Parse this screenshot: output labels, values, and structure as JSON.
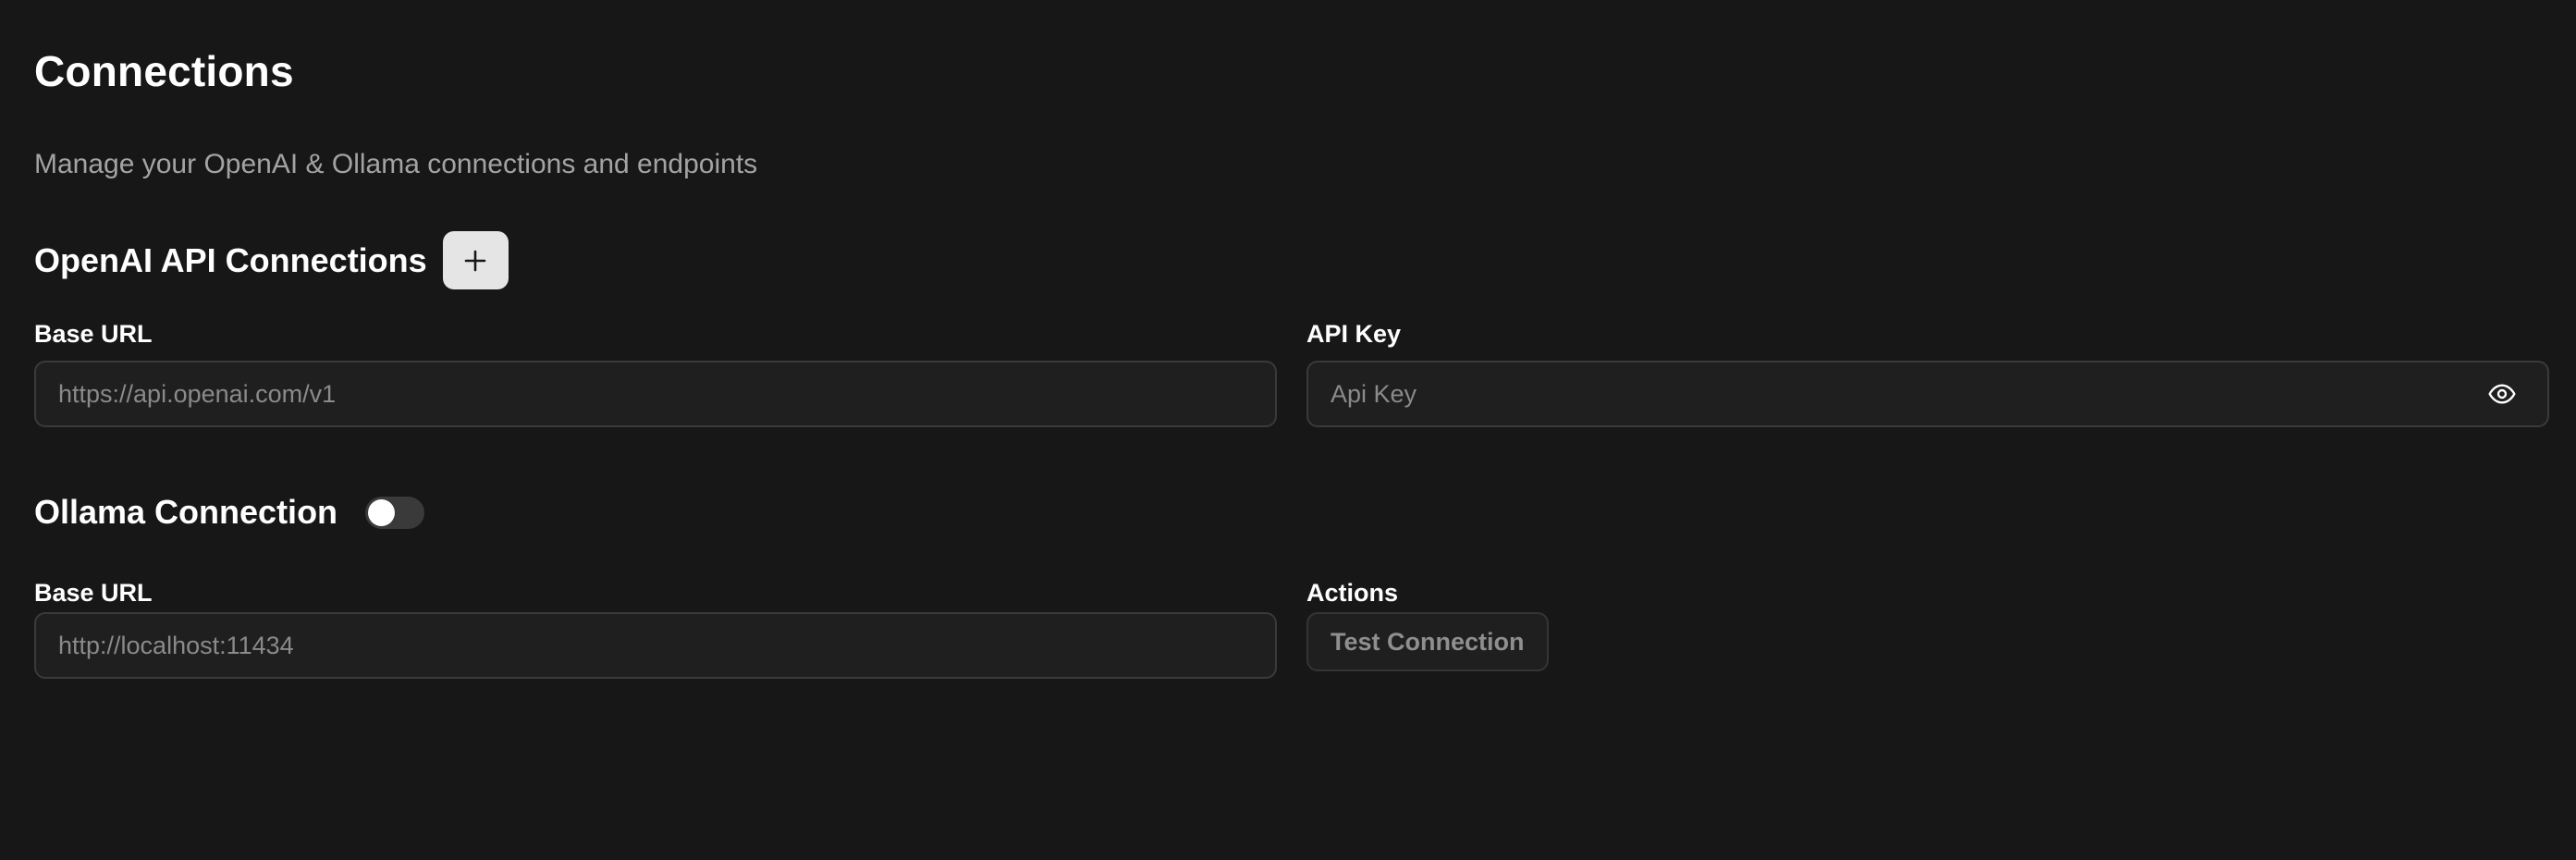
{
  "page": {
    "title": "Connections",
    "subtitle": "Manage your OpenAI & Ollama connections and endpoints"
  },
  "openai": {
    "heading": "OpenAI API Connections",
    "add_button_icon": "plus-icon",
    "base_url_label": "Base URL",
    "base_url_placeholder": "https://api.openai.com/v1",
    "base_url_value": "",
    "api_key_label": "API Key",
    "api_key_placeholder": "Api Key",
    "api_key_value": "",
    "visibility_icon": "eye-icon"
  },
  "ollama": {
    "heading": "Ollama Connection",
    "toggle_enabled": false,
    "base_url_label": "Base URL",
    "base_url_placeholder": "http://localhost:11434",
    "base_url_value": "",
    "actions_label": "Actions",
    "test_button_label": "Test Connection"
  },
  "colors": {
    "background": "#171717",
    "input_background": "#1f1f1f",
    "input_border": "#3a3a3a",
    "muted_text": "#a3a3a3",
    "add_button_bg": "#e5e5e5"
  }
}
